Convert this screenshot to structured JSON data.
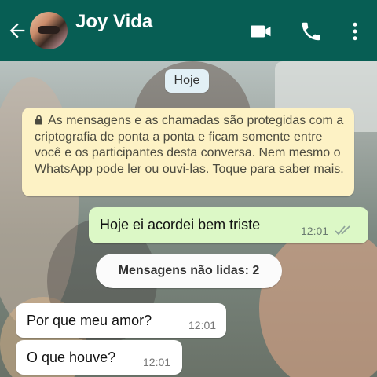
{
  "header": {
    "contact_name": "Joy Vida",
    "back_icon": "arrow-left-icon",
    "video_icon": "video-camera-icon",
    "call_icon": "phone-icon",
    "menu_icon": "more-vertical-icon",
    "color": "#075e54"
  },
  "chat": {
    "date_label": "Hoje",
    "encryption_notice": "As mensagens e as chamadas são protegidas com a criptografia de ponta a ponta e ficam somente entre você e os participantes desta conversa. Nem mesmo o WhatsApp pode ler ou ouvi-las. Toque para saber mais.",
    "unread_label": "Mensagens não lidas: 2",
    "messages": [
      {
        "direction": "outgoing",
        "text": "Hoje ei acordei bem triste",
        "time": "12:01",
        "status": "read"
      },
      {
        "direction": "incoming",
        "text": "Por que meu amor?",
        "time": "12:01"
      },
      {
        "direction": "incoming",
        "text": "O que houve?",
        "time": "12:01"
      }
    ]
  },
  "colors": {
    "outgoing_bubble": "#dcf8c6",
    "incoming_bubble": "#ffffff",
    "notice_bubble": "#fdf2c5",
    "read_ticks": "#4fc3f7"
  }
}
